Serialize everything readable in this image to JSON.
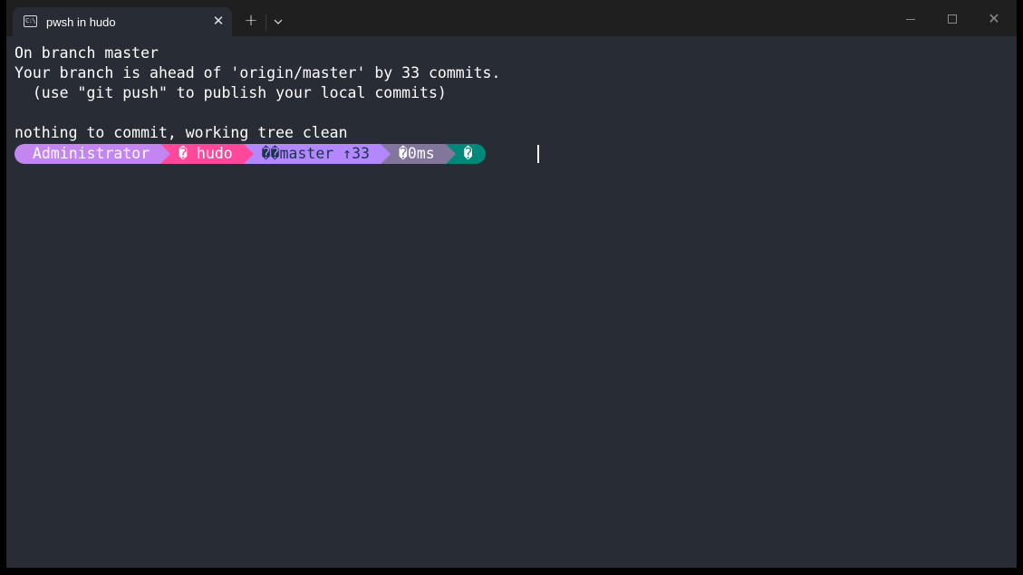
{
  "tab": {
    "icon": "terminal-icon",
    "title": "pwsh in hudo",
    "close": "✕"
  },
  "titlebar": {
    "new_tab": "+",
    "dropdown": "⌄",
    "minimize": "minimize-icon",
    "maximize": "maximize-icon",
    "close": "✕"
  },
  "terminal": {
    "lines": [
      "On branch master",
      "Your branch is ahead of 'origin/master' by 33 commits.",
      "  (use \"git push\" to publish your local commits)",
      "",
      "nothing to commit, working tree clean"
    ],
    "prompt": {
      "user": "Administrator",
      "path": "� hudo",
      "git": "��master ↑33",
      "time": "�0ms",
      "status": "�"
    }
  },
  "colors": {
    "background": "#282c34",
    "user_segment": "#c386f1",
    "path_segment": "#ff479c",
    "git_segment": "#b388ff",
    "time_segment": "#83769c",
    "status_segment": "#00897b"
  }
}
